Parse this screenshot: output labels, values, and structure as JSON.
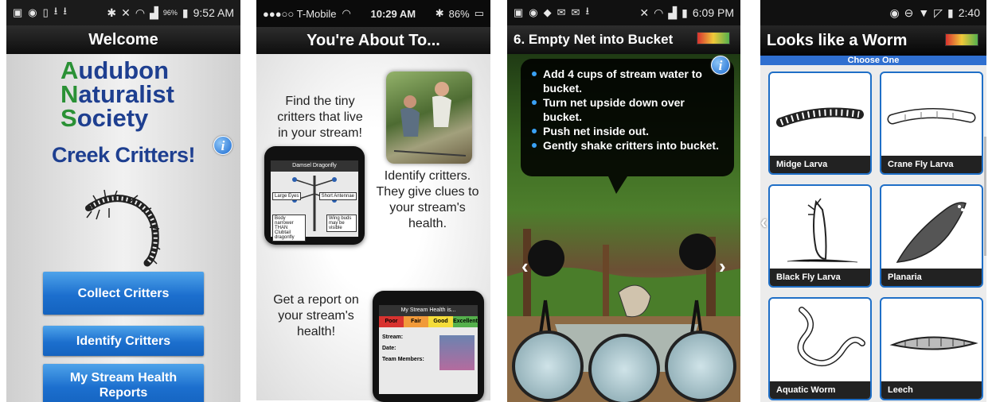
{
  "phone1": {
    "status_time": "9:52 AM",
    "status_battery": "96%",
    "title": "Welcome",
    "logo_lines": [
      {
        "initial": "A",
        "rest": "udubon"
      },
      {
        "initial": "N",
        "rest": "aturalist"
      },
      {
        "initial": "S",
        "rest": "ociety"
      }
    ],
    "app_title": "Creek Critters!",
    "buttons": {
      "collect": "Collect Critters",
      "identify": "Identify Critters",
      "reports": "My Stream Health Reports"
    }
  },
  "phone2": {
    "status_carrier": "●●●○○ T-Mobile",
    "status_time": "10:29 AM",
    "status_battery": "86%",
    "title": "You're About To...",
    "item1": "Find the tiny critters that live in your stream!",
    "item2": "Identify critters. They give clues to your stream's health.",
    "item3": "Get a report on your stream's health!",
    "mock1_title": "Damsel Dragonfly",
    "mock1_tags": [
      "Large Eyes",
      "Short Antennae",
      "Body narrower THAN Clubtail dragonfly",
      "Wing buds may be visible"
    ],
    "mock2_title": "My Stream Health is...",
    "mock2_rating": [
      "Poor",
      "Fair",
      "Good",
      "Excellent"
    ],
    "mock2_fields": [
      "Stream:",
      "Date:",
      "Team Members:"
    ]
  },
  "phone3": {
    "status_time": "6:09 PM",
    "title": "6. Empty Net into Bucket",
    "steps": [
      "Add 4 cups of stream water to bucket.",
      "Turn net upside down over bucket.",
      "Push net inside out.",
      "Gently shake critters into bucket."
    ]
  },
  "phone4": {
    "status_time": "2:40",
    "title": "Looks like a Worm",
    "subtitle": "Choose One",
    "critters": [
      "Midge Larva",
      "Crane Fly Larva",
      "Black Fly Larva",
      "Planaria",
      "Aquatic Worm",
      "Leech"
    ]
  }
}
